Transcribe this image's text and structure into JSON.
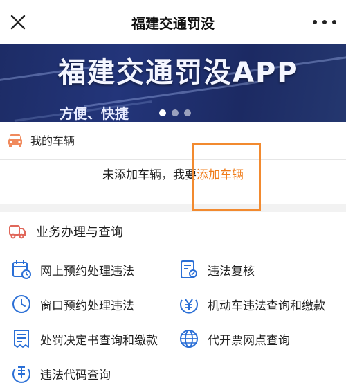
{
  "header": {
    "title": "福建交通罚没",
    "close_icon": "close-icon",
    "more_icon": "more-icon"
  },
  "banner": {
    "title": "福建交通罚没APP",
    "subtitle": "方便、快捷",
    "pager": {
      "count": 3,
      "active": 1
    }
  },
  "vehicle": {
    "section_title": "我的车辆",
    "empty_text": "未添加车辆，我要",
    "add_link": "添加车辆",
    "icon": "car-icon"
  },
  "services": {
    "section_title": "业务办理与查询",
    "icon": "truck-icon",
    "items": [
      {
        "label": "网上预约处理违法",
        "icon": "calendar-clock-icon"
      },
      {
        "label": "违法复核",
        "icon": "document-edit-icon"
      },
      {
        "label": "窗口预约处理违法",
        "icon": "clock-icon"
      },
      {
        "label": "机动车违法查询和缴款",
        "icon": "yen-coin-icon"
      },
      {
        "label": "处罚决定书查询和缴款",
        "icon": "receipt-icon"
      },
      {
        "label": "代开票网点查询",
        "icon": "globe-icon"
      },
      {
        "label": "违法代码查询",
        "icon": "code-lookup-icon"
      }
    ]
  },
  "colors": {
    "accent": "#f07c19",
    "icon_blue": "#2a6fd6",
    "banner_bg": "#1f2f6e"
  }
}
